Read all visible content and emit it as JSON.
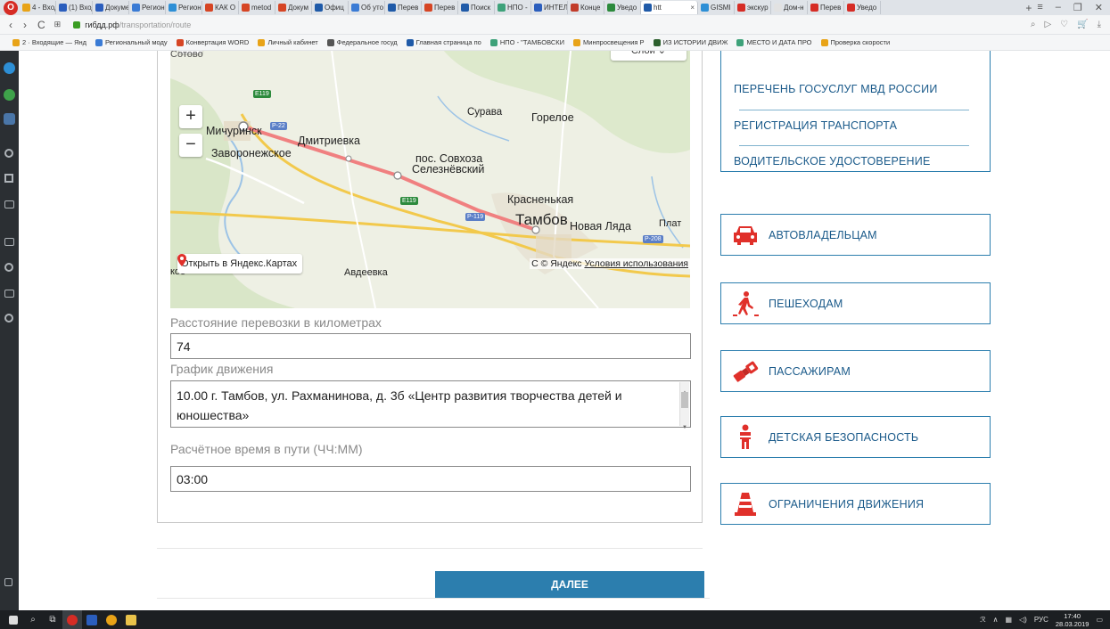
{
  "browser": {
    "tabs": [
      {
        "label": "4 - Вход",
        "color": "#e8a317"
      },
      {
        "label": "(1) Вход",
        "color": "#2b5ebd"
      },
      {
        "label": "Докумен",
        "color": "#2b5ebd"
      },
      {
        "label": "Регион",
        "color": "#3a7bd5"
      },
      {
        "label": "Регион",
        "color": "#2d8fd6"
      },
      {
        "label": "КАК О",
        "color": "#d64524"
      },
      {
        "label": "metod",
        "color": "#d64524"
      },
      {
        "label": "Докум",
        "color": "#d64524"
      },
      {
        "label": "Офиц",
        "color": "#1f5aa8"
      },
      {
        "label": "Об уто",
        "color": "#3a7bd5"
      },
      {
        "label": "Перев",
        "color": "#1f5aa8"
      },
      {
        "label": "Перев",
        "color": "#d64524"
      },
      {
        "label": "Поиск",
        "color": "#1f5aa8"
      },
      {
        "label": "НПО -",
        "color": "#3ea27a"
      },
      {
        "label": "ИНТЕЛ",
        "color": "#2b5ebd"
      },
      {
        "label": "Конце",
        "color": "#c23c2a"
      },
      {
        "label": "Уведо",
        "color": "#2c8a3c"
      },
      {
        "label": "htt",
        "color": "#1f5aa8",
        "active": true
      },
      {
        "label": "GISMI",
        "color": "#2d8fd6"
      },
      {
        "label": "экскур",
        "color": "#d62c25"
      },
      {
        "label": "Дом-н",
        "color": "#e2e2e2"
      },
      {
        "label": "Перев",
        "color": "#d62c25"
      },
      {
        "label": "Уведо",
        "color": "#d62c25"
      }
    ],
    "url_host": "гибдд.рф",
    "url_path": "/transportation/route",
    "bookmarks": [
      {
        "label": "2 · Входящие — Янд",
        "color": "#e8a317"
      },
      {
        "label": "Региональный моду",
        "color": "#3a7bd5"
      },
      {
        "label": "Конвертация WORD",
        "color": "#d64524"
      },
      {
        "label": "Личный кабинет",
        "color": "#e8a317"
      },
      {
        "label": "Федеральное госуд",
        "color": "#555555"
      },
      {
        "label": "Главная страница по",
        "color": "#1f5aa8"
      },
      {
        "label": "НПО - \"ТАМБОВСКИ",
        "color": "#3ea27a"
      },
      {
        "label": "Минпросвещения Р",
        "color": "#e8a317"
      },
      {
        "label": "ИЗ ИСТОРИИ ДВИЖ",
        "color": "#2c5f2d"
      },
      {
        "label": "МЕСТО И ДАТА ПРО",
        "color": "#3ea27a"
      },
      {
        "label": "Проверка скорости",
        "color": "#e8a317"
      }
    ]
  },
  "map": {
    "layers_label": "Слои ⌄",
    "top_town": "Сотово",
    "labels": [
      {
        "id": "michurinsk",
        "text": "Мичуринск"
      },
      {
        "id": "dmitrievka",
        "text": "Дмитриевка"
      },
      {
        "id": "zavoronezhskoe",
        "text": "Заворонежское"
      },
      {
        "id": "surava",
        "text": "Сурава"
      },
      {
        "id": "gorelo",
        "text": "Горелое"
      },
      {
        "id": "sovkhoz",
        "text": "пос. Совхоза"
      },
      {
        "id": "seleznevsky",
        "text": "Селезнёвский"
      },
      {
        "id": "krasnenkaya",
        "text": "Красненькая"
      },
      {
        "id": "tambov",
        "text": "Тамбов"
      },
      {
        "id": "novaya",
        "text": "Новая Ляда"
      },
      {
        "id": "plat",
        "text": "Плат"
      },
      {
        "id": "avdeevka",
        "text": "Авдеевка"
      },
      {
        "id": "koe",
        "text": "кое"
      }
    ],
    "road_tags": [
      {
        "id": "e119a",
        "text": "E119"
      },
      {
        "id": "p22",
        "text": "P-22"
      },
      {
        "id": "e119b",
        "text": "E119"
      },
      {
        "id": "p119",
        "text": "P-119"
      },
      {
        "id": "p208",
        "text": "P-208"
      }
    ],
    "zoom_in": "+",
    "zoom_out": "−",
    "open_label": "Открыть в Яндекс.Картах",
    "copyright": "С  © Яндекс",
    "terms": "Условия использования"
  },
  "form": {
    "distance_label": "Расстояние перевозки в километрах",
    "distance_value": "74",
    "schedule_label": "График движения",
    "schedule_value": "10.00   г. Тамбов, ул. Рахманинова, д. 3б «Центр развития творчества детей и юношества»",
    "time_label": "Расчётное время в пути (ЧЧ:ММ)",
    "time_value": "03:00",
    "next_label": "ДАЛЕЕ"
  },
  "menu": {
    "services": [
      "ПЕРЕЧЕНЬ ГОСУСЛУГ МВД РОССИИ",
      "РЕГИСТРАЦИЯ ТРАНСПОРТА",
      "ВОДИТЕЛЬСКОЕ УДОСТОВЕРЕНИЕ"
    ],
    "categories": [
      {
        "label": "АВТОВЛАДЕЛЬЦАМ",
        "icon": "car-icon"
      },
      {
        "label": "ПЕШЕХОДАМ",
        "icon": "pedestrian-icon"
      },
      {
        "label": "ПАССАЖИРАМ",
        "icon": "seatbelt-icon"
      },
      {
        "label": "ДЕТСКАЯ БЕЗОПАСНОСТЬ",
        "icon": "child-icon"
      },
      {
        "label": "ОГРАНИЧЕНИЯ ДВИЖЕНИЯ",
        "icon": "traffic-cone-icon"
      }
    ],
    "accent": "#2c7eae",
    "icon_red": "#e0302a"
  },
  "taskbar": {
    "lang": "РУС",
    "time": "17:40",
    "date": "28.03.2019"
  }
}
